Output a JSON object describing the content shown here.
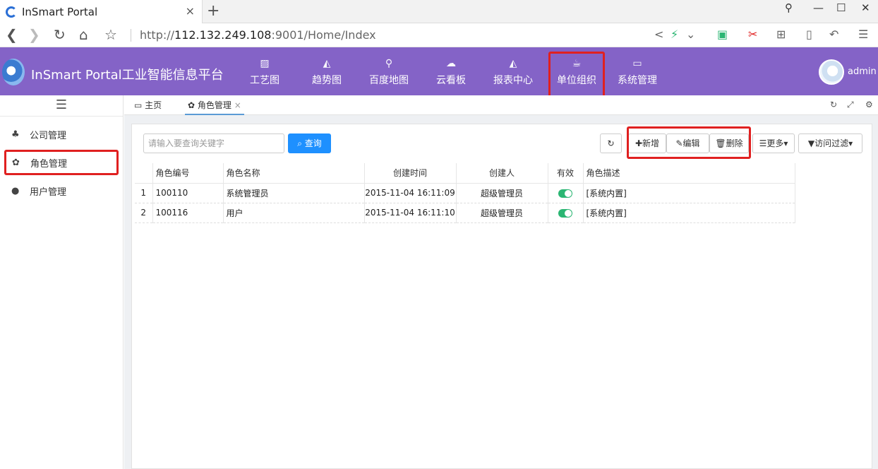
{
  "browser": {
    "tab_title": "InSmart Portal",
    "close_tab": "×",
    "new_tab": "+",
    "url_prefix": "http://",
    "url_host": "112.132.249.108",
    "url_rest": ":9001/Home/Index"
  },
  "header": {
    "brand": "InSmart Portal工业智能信息平台",
    "user": "admin",
    "nav": [
      {
        "label": "工艺图",
        "icon": "image-icon"
      },
      {
        "label": "趋势图",
        "icon": "area-chart-icon"
      },
      {
        "label": "百度地图",
        "icon": "map-marker-icon"
      },
      {
        "label": "云看板",
        "icon": "cloud-icon"
      },
      {
        "label": "报表中心",
        "icon": "area-chart-icon"
      },
      {
        "label": "单位组织",
        "icon": "coffee-icon",
        "active": true
      },
      {
        "label": "系统管理",
        "icon": "desktop-icon"
      }
    ]
  },
  "sidebar": {
    "items": [
      {
        "label": "公司管理",
        "icon": "sitemap-icon"
      },
      {
        "label": "角色管理",
        "icon": "paw-icon",
        "active": true
      },
      {
        "label": "用户管理",
        "icon": "user-icon"
      }
    ]
  },
  "content_tabs": [
    {
      "label": "主页",
      "icon": "desktop-icon"
    },
    {
      "label": "角色管理",
      "icon": "paw-icon",
      "close": "×",
      "active": true
    }
  ],
  "toolbar": {
    "search_placeholder": "请输入要查询关键字",
    "query_label": "查询",
    "add_label": "新增",
    "edit_label": "编辑",
    "delete_label": "删除",
    "more_label": "更多",
    "filter_label": "访问过滤"
  },
  "table": {
    "columns": [
      "角色编号",
      "角色名称",
      "创建时间",
      "创建人",
      "有效",
      "角色描述"
    ],
    "rows": [
      {
        "index": "1",
        "code": "100110",
        "name": "系统管理员",
        "created": "2015-11-04 16:11:09",
        "creator": "超级管理员",
        "valid": true,
        "desc": "[系统内置]"
      },
      {
        "index": "2",
        "code": "100116",
        "name": "用户",
        "created": "2015-11-04 16:11:10",
        "creator": "超级管理员",
        "valid": true,
        "desc": "[系统内置]"
      }
    ]
  },
  "colors": {
    "header_bg": "#8463c7",
    "accent_blue": "#1e90ff",
    "toggle_green": "#2bb673",
    "highlight_red": "#e02020"
  }
}
